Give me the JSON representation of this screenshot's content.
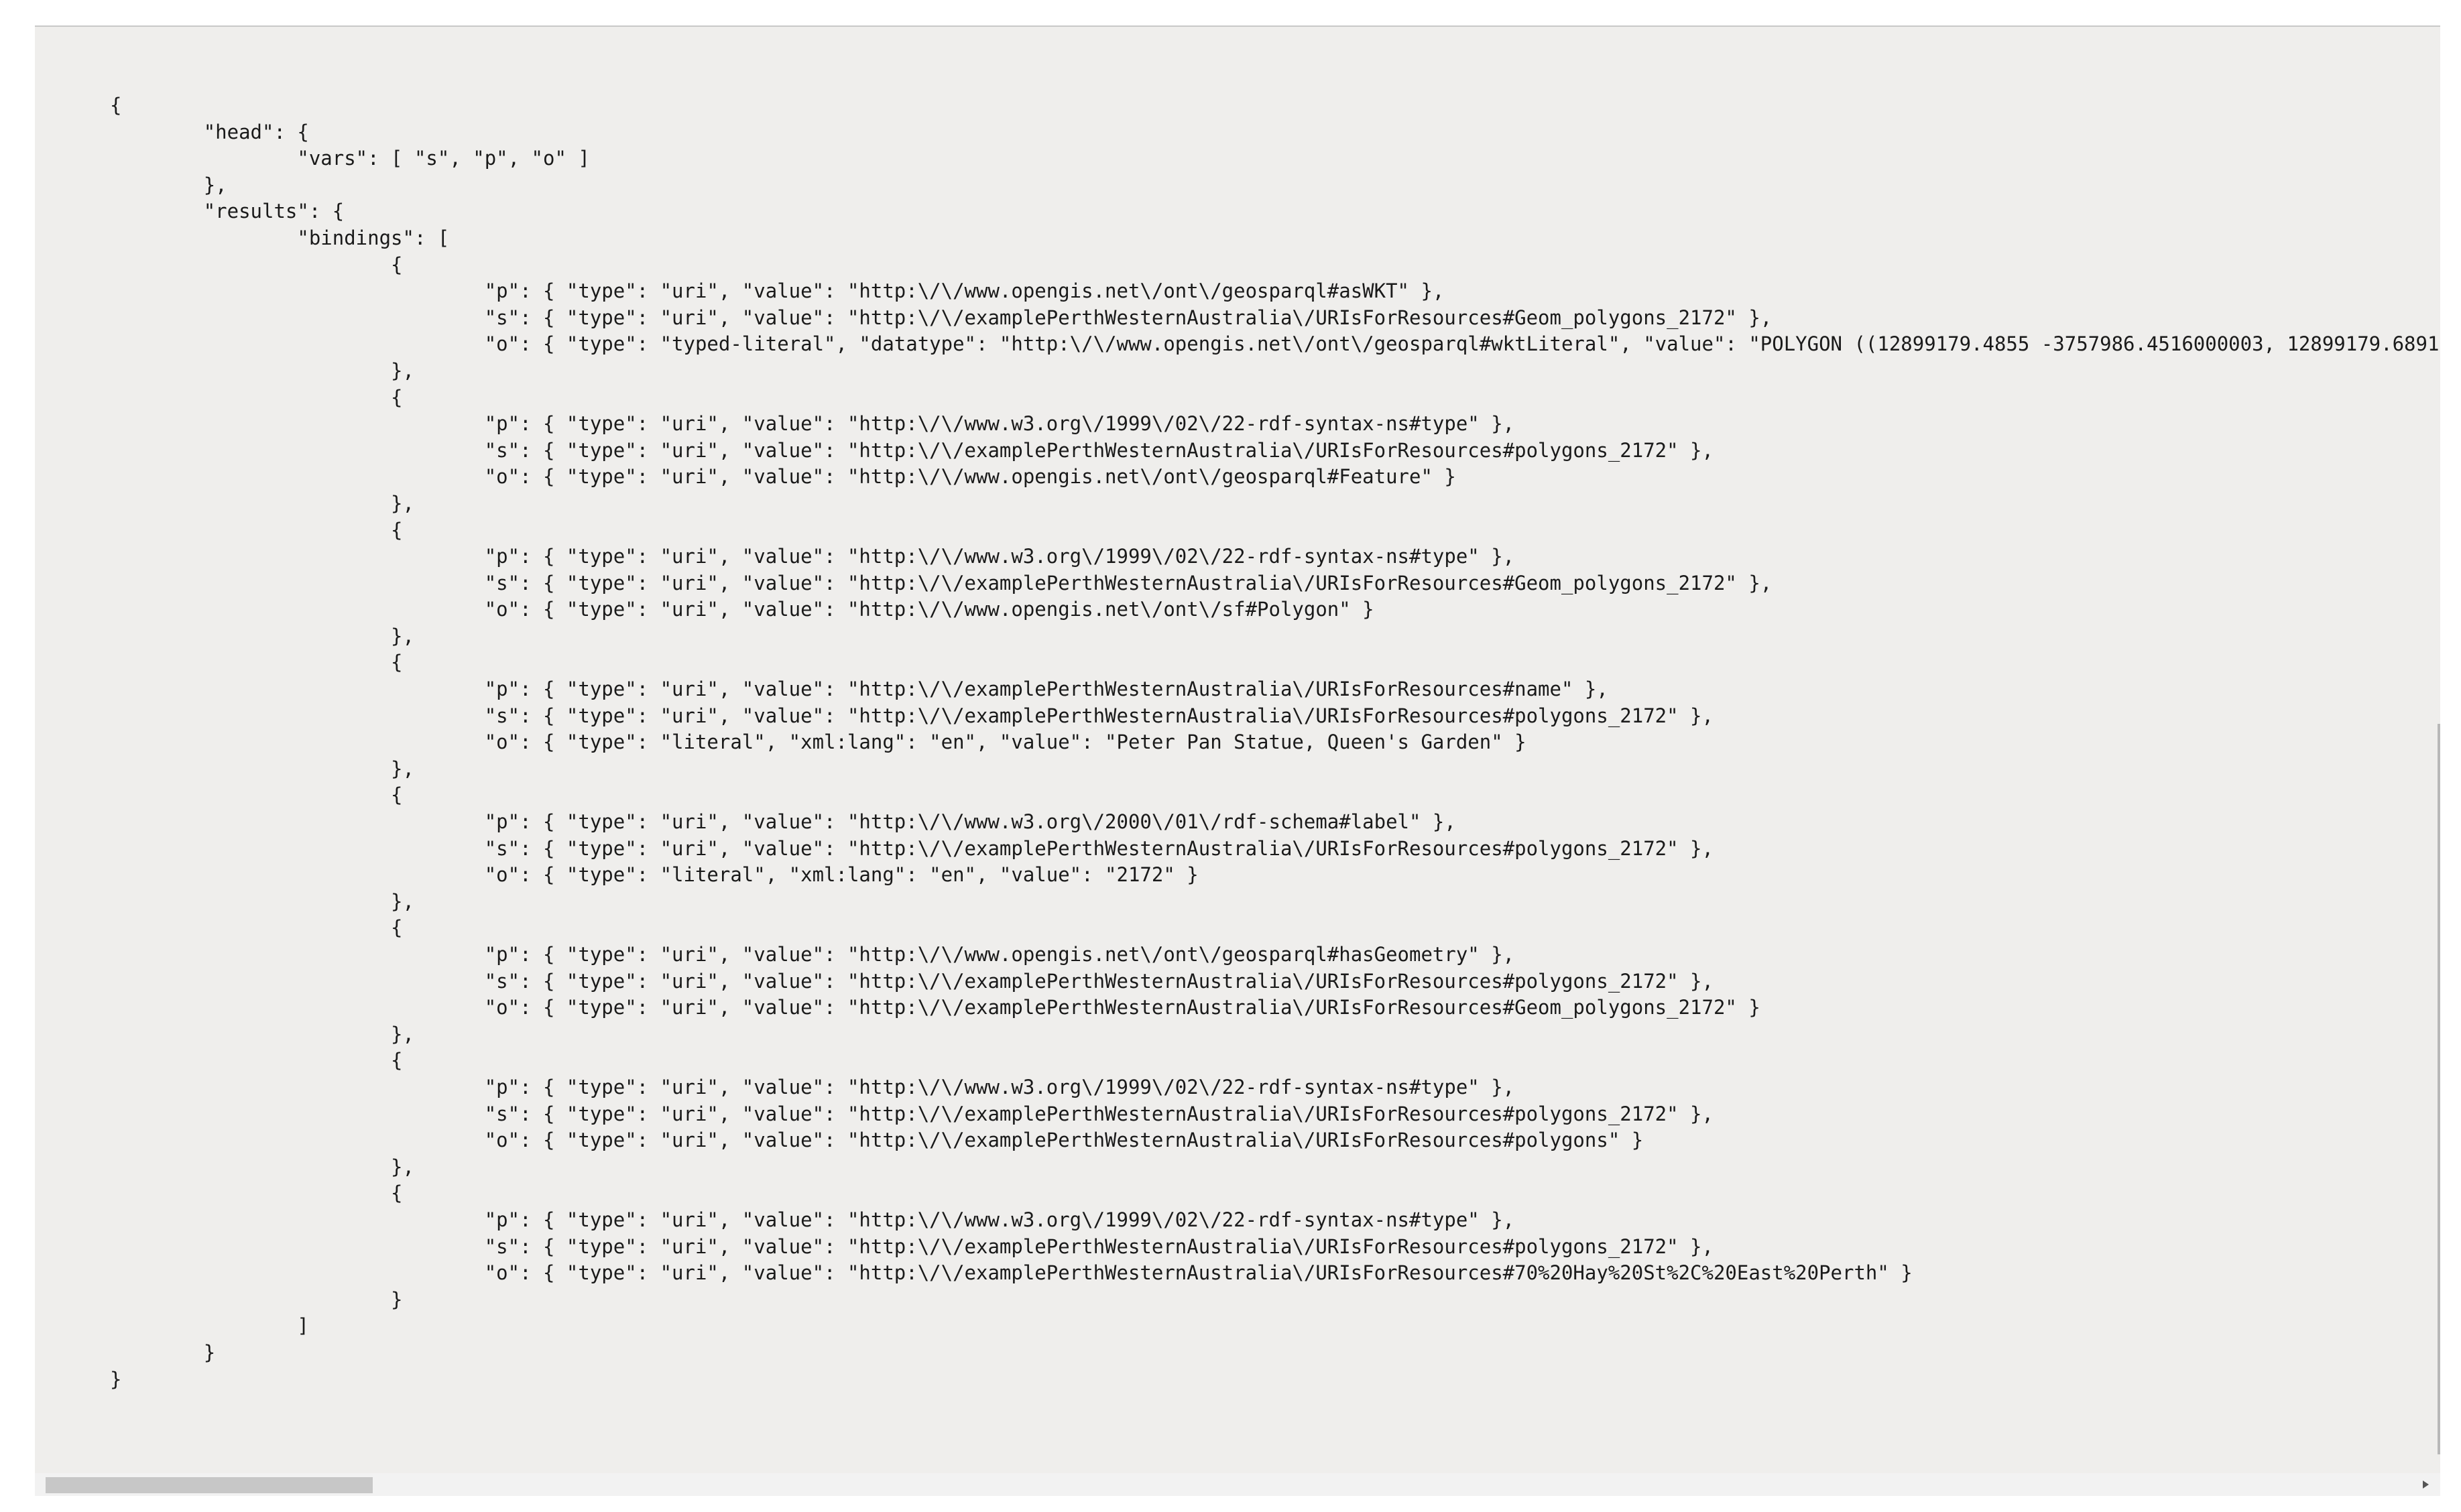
{
  "result_text": "{\n\t\"head\": {\n\t\t\"vars\": [ \"s\", \"p\", \"o\" ]\n\t},\n\t\"results\": {\n\t\t\"bindings\": [\n\t\t\t{\n\t\t\t\t\"p\": { \"type\": \"uri\", \"value\": \"http:\\/\\/www.opengis.net\\/ont\\/geosparql#asWKT\" },\n\t\t\t\t\"s\": { \"type\": \"uri\", \"value\": \"http:\\/\\/examplePerthWesternAustralia\\/URIsForResources#Geom_polygons_2172\" },\n\t\t\t\t\"o\": { \"type\": \"typed-literal\", \"datatype\": \"http:\\/\\/www.opengis.net\\/ont\\/geosparql#wktLiteral\", \"value\": \"POLYGON ((12899179.4855 -3757986.4516000003, 12899179.6891\n\t\t\t},\n\t\t\t{\n\t\t\t\t\"p\": { \"type\": \"uri\", \"value\": \"http:\\/\\/www.w3.org\\/1999\\/02\\/22-rdf-syntax-ns#type\" },\n\t\t\t\t\"s\": { \"type\": \"uri\", \"value\": \"http:\\/\\/examplePerthWesternAustralia\\/URIsForResources#polygons_2172\" },\n\t\t\t\t\"o\": { \"type\": \"uri\", \"value\": \"http:\\/\\/www.opengis.net\\/ont\\/geosparql#Feature\" }\n\t\t\t},\n\t\t\t{\n\t\t\t\t\"p\": { \"type\": \"uri\", \"value\": \"http:\\/\\/www.w3.org\\/1999\\/02\\/22-rdf-syntax-ns#type\" },\n\t\t\t\t\"s\": { \"type\": \"uri\", \"value\": \"http:\\/\\/examplePerthWesternAustralia\\/URIsForResources#Geom_polygons_2172\" },\n\t\t\t\t\"o\": { \"type\": \"uri\", \"value\": \"http:\\/\\/www.opengis.net\\/ont\\/sf#Polygon\" }\n\t\t\t},\n\t\t\t{\n\t\t\t\t\"p\": { \"type\": \"uri\", \"value\": \"http:\\/\\/examplePerthWesternAustralia\\/URIsForResources#name\" },\n\t\t\t\t\"s\": { \"type\": \"uri\", \"value\": \"http:\\/\\/examplePerthWesternAustralia\\/URIsForResources#polygons_2172\" },\n\t\t\t\t\"o\": { \"type\": \"literal\", \"xml:lang\": \"en\", \"value\": \"Peter Pan Statue, Queen's Garden\" }\n\t\t\t},\n\t\t\t{\n\t\t\t\t\"p\": { \"type\": \"uri\", \"value\": \"http:\\/\\/www.w3.org\\/2000\\/01\\/rdf-schema#label\" },\n\t\t\t\t\"s\": { \"type\": \"uri\", \"value\": \"http:\\/\\/examplePerthWesternAustralia\\/URIsForResources#polygons_2172\" },\n\t\t\t\t\"o\": { \"type\": \"literal\", \"xml:lang\": \"en\", \"value\": \"2172\" }\n\t\t\t},\n\t\t\t{\n\t\t\t\t\"p\": { \"type\": \"uri\", \"value\": \"http:\\/\\/www.opengis.net\\/ont\\/geosparql#hasGeometry\" },\n\t\t\t\t\"s\": { \"type\": \"uri\", \"value\": \"http:\\/\\/examplePerthWesternAustralia\\/URIsForResources#polygons_2172\" },\n\t\t\t\t\"o\": { \"type\": \"uri\", \"value\": \"http:\\/\\/examplePerthWesternAustralia\\/URIsForResources#Geom_polygons_2172\" }\n\t\t\t},\n\t\t\t{\n\t\t\t\t\"p\": { \"type\": \"uri\", \"value\": \"http:\\/\\/www.w3.org\\/1999\\/02\\/22-rdf-syntax-ns#type\" },\n\t\t\t\t\"s\": { \"type\": \"uri\", \"value\": \"http:\\/\\/examplePerthWesternAustralia\\/URIsForResources#polygons_2172\" },\n\t\t\t\t\"o\": { \"type\": \"uri\", \"value\": \"http:\\/\\/examplePerthWesternAustralia\\/URIsForResources#polygons\" }\n\t\t\t},\n\t\t\t{\n\t\t\t\t\"p\": { \"type\": \"uri\", \"value\": \"http:\\/\\/www.w3.org\\/1999\\/02\\/22-rdf-syntax-ns#type\" },\n\t\t\t\t\"s\": { \"type\": \"uri\", \"value\": \"http:\\/\\/examplePerthWesternAustralia\\/URIsForResources#polygons_2172\" },\n\t\t\t\t\"o\": { \"type\": \"uri\", \"value\": \"http:\\/\\/examplePerthWesternAustralia\\/URIsForResources#70%20Hay%20St%2C%20East%20Perth\" }\n\t\t\t}\n\t\t]\n\t}\n}",
  "icons": {
    "scroll_right": "triangle-right-icon"
  },
  "colors": {
    "panel_background": "#efeeec",
    "text": "#1a1a1a",
    "scroll_thumb": "#c7c7c7"
  }
}
